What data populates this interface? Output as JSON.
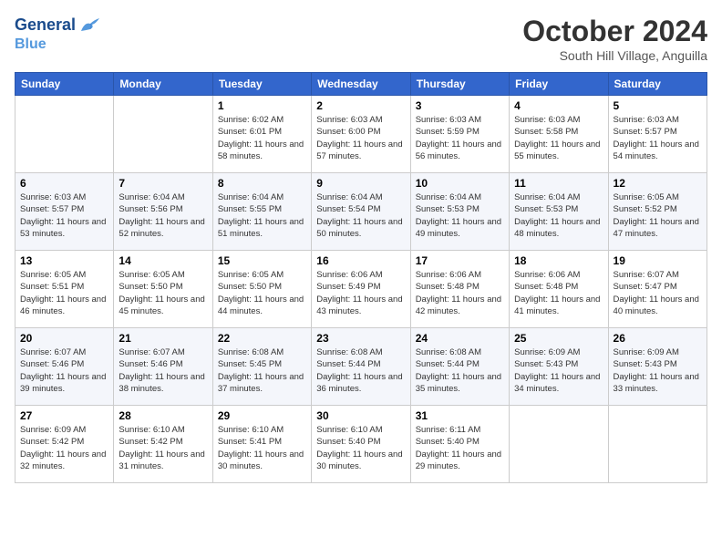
{
  "header": {
    "logo_line1": "General",
    "logo_line2": "Blue",
    "month": "October 2024",
    "location": "South Hill Village, Anguilla"
  },
  "weekdays": [
    "Sunday",
    "Monday",
    "Tuesday",
    "Wednesday",
    "Thursday",
    "Friday",
    "Saturday"
  ],
  "weeks": [
    [
      {
        "day": "",
        "info": ""
      },
      {
        "day": "",
        "info": ""
      },
      {
        "day": "1",
        "info": "Sunrise: 6:02 AM\nSunset: 6:01 PM\nDaylight: 11 hours and 58 minutes."
      },
      {
        "day": "2",
        "info": "Sunrise: 6:03 AM\nSunset: 6:00 PM\nDaylight: 11 hours and 57 minutes."
      },
      {
        "day": "3",
        "info": "Sunrise: 6:03 AM\nSunset: 5:59 PM\nDaylight: 11 hours and 56 minutes."
      },
      {
        "day": "4",
        "info": "Sunrise: 6:03 AM\nSunset: 5:58 PM\nDaylight: 11 hours and 55 minutes."
      },
      {
        "day": "5",
        "info": "Sunrise: 6:03 AM\nSunset: 5:57 PM\nDaylight: 11 hours and 54 minutes."
      }
    ],
    [
      {
        "day": "6",
        "info": "Sunrise: 6:03 AM\nSunset: 5:57 PM\nDaylight: 11 hours and 53 minutes."
      },
      {
        "day": "7",
        "info": "Sunrise: 6:04 AM\nSunset: 5:56 PM\nDaylight: 11 hours and 52 minutes."
      },
      {
        "day": "8",
        "info": "Sunrise: 6:04 AM\nSunset: 5:55 PM\nDaylight: 11 hours and 51 minutes."
      },
      {
        "day": "9",
        "info": "Sunrise: 6:04 AM\nSunset: 5:54 PM\nDaylight: 11 hours and 50 minutes."
      },
      {
        "day": "10",
        "info": "Sunrise: 6:04 AM\nSunset: 5:53 PM\nDaylight: 11 hours and 49 minutes."
      },
      {
        "day": "11",
        "info": "Sunrise: 6:04 AM\nSunset: 5:53 PM\nDaylight: 11 hours and 48 minutes."
      },
      {
        "day": "12",
        "info": "Sunrise: 6:05 AM\nSunset: 5:52 PM\nDaylight: 11 hours and 47 minutes."
      }
    ],
    [
      {
        "day": "13",
        "info": "Sunrise: 6:05 AM\nSunset: 5:51 PM\nDaylight: 11 hours and 46 minutes."
      },
      {
        "day": "14",
        "info": "Sunrise: 6:05 AM\nSunset: 5:50 PM\nDaylight: 11 hours and 45 minutes."
      },
      {
        "day": "15",
        "info": "Sunrise: 6:05 AM\nSunset: 5:50 PM\nDaylight: 11 hours and 44 minutes."
      },
      {
        "day": "16",
        "info": "Sunrise: 6:06 AM\nSunset: 5:49 PM\nDaylight: 11 hours and 43 minutes."
      },
      {
        "day": "17",
        "info": "Sunrise: 6:06 AM\nSunset: 5:48 PM\nDaylight: 11 hours and 42 minutes."
      },
      {
        "day": "18",
        "info": "Sunrise: 6:06 AM\nSunset: 5:48 PM\nDaylight: 11 hours and 41 minutes."
      },
      {
        "day": "19",
        "info": "Sunrise: 6:07 AM\nSunset: 5:47 PM\nDaylight: 11 hours and 40 minutes."
      }
    ],
    [
      {
        "day": "20",
        "info": "Sunrise: 6:07 AM\nSunset: 5:46 PM\nDaylight: 11 hours and 39 minutes."
      },
      {
        "day": "21",
        "info": "Sunrise: 6:07 AM\nSunset: 5:46 PM\nDaylight: 11 hours and 38 minutes."
      },
      {
        "day": "22",
        "info": "Sunrise: 6:08 AM\nSunset: 5:45 PM\nDaylight: 11 hours and 37 minutes."
      },
      {
        "day": "23",
        "info": "Sunrise: 6:08 AM\nSunset: 5:44 PM\nDaylight: 11 hours and 36 minutes."
      },
      {
        "day": "24",
        "info": "Sunrise: 6:08 AM\nSunset: 5:44 PM\nDaylight: 11 hours and 35 minutes."
      },
      {
        "day": "25",
        "info": "Sunrise: 6:09 AM\nSunset: 5:43 PM\nDaylight: 11 hours and 34 minutes."
      },
      {
        "day": "26",
        "info": "Sunrise: 6:09 AM\nSunset: 5:43 PM\nDaylight: 11 hours and 33 minutes."
      }
    ],
    [
      {
        "day": "27",
        "info": "Sunrise: 6:09 AM\nSunset: 5:42 PM\nDaylight: 11 hours and 32 minutes."
      },
      {
        "day": "28",
        "info": "Sunrise: 6:10 AM\nSunset: 5:42 PM\nDaylight: 11 hours and 31 minutes."
      },
      {
        "day": "29",
        "info": "Sunrise: 6:10 AM\nSunset: 5:41 PM\nDaylight: 11 hours and 30 minutes."
      },
      {
        "day": "30",
        "info": "Sunrise: 6:10 AM\nSunset: 5:40 PM\nDaylight: 11 hours and 30 minutes."
      },
      {
        "day": "31",
        "info": "Sunrise: 6:11 AM\nSunset: 5:40 PM\nDaylight: 11 hours and 29 minutes."
      },
      {
        "day": "",
        "info": ""
      },
      {
        "day": "",
        "info": ""
      }
    ]
  ]
}
